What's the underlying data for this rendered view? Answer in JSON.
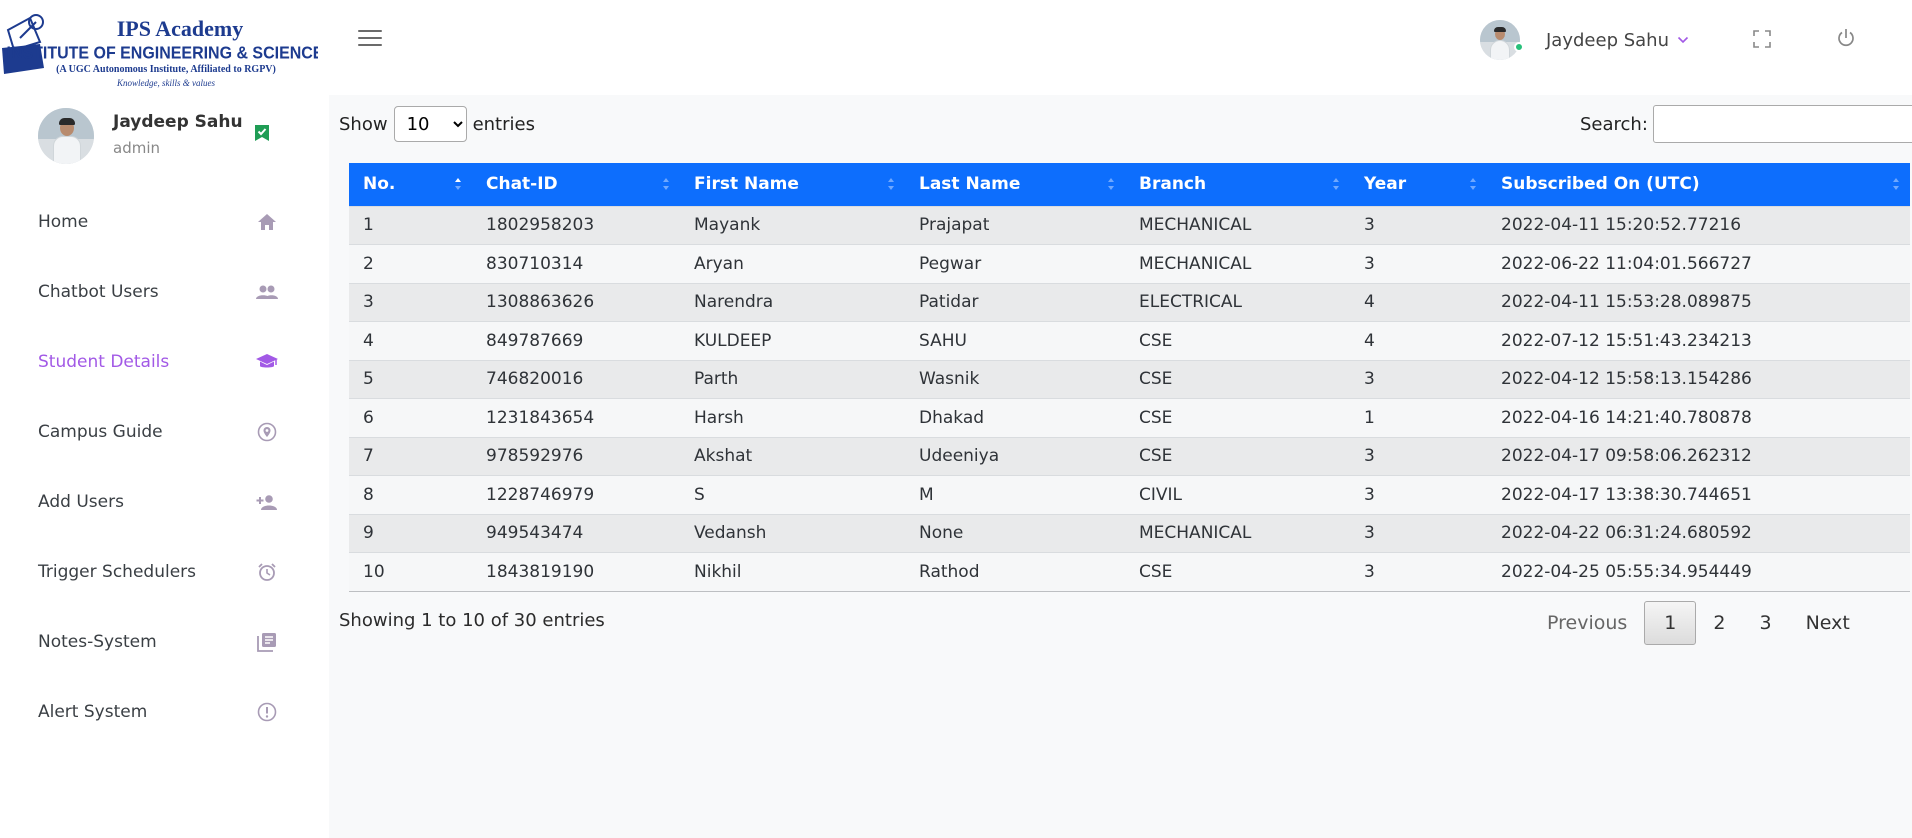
{
  "brand": {
    "name": "IPS Academy",
    "institute": "INSTITUTE OF ENGINEERING & SCIENCE",
    "affiliation": "(A UGC Autonomous Institute, Affiliated to RGPV)",
    "motto": "Knowledge, skills & values"
  },
  "user": {
    "name": "Jaydeep Sahu",
    "role": "admin"
  },
  "sidebar": {
    "items": [
      {
        "label": "Home",
        "icon": "home-icon",
        "active": false
      },
      {
        "label": "Chatbot Users",
        "icon": "users-icon",
        "active": false
      },
      {
        "label": "Student Details",
        "icon": "graduation-cap-icon",
        "active": true
      },
      {
        "label": "Campus Guide",
        "icon": "location-pin-icon",
        "active": false
      },
      {
        "label": "Add Users",
        "icon": "add-user-icon",
        "active": false
      },
      {
        "label": "Trigger Schedulers",
        "icon": "alarm-clock-icon",
        "active": false
      },
      {
        "label": "Notes-System",
        "icon": "notes-icon",
        "active": false
      },
      {
        "label": "Alert System",
        "icon": "alert-circle-icon",
        "active": false
      }
    ]
  },
  "colors": {
    "accent": "#a259e6",
    "header_blue": "#0d6efd",
    "online": "#27c07a"
  },
  "table_controls": {
    "show_label": "Show",
    "entries_label": "entries",
    "page_length": "10",
    "search_label": "Search:",
    "search_value": ""
  },
  "table": {
    "columns": [
      "No.",
      "Chat-ID",
      "First Name",
      "Last Name",
      "Branch",
      "Year",
      "Subscribed On (UTC)"
    ],
    "rows": [
      [
        "1",
        "1802958203",
        "Mayank",
        "Prajapat",
        "MECHANICAL",
        "3",
        "2022-04-11 15:20:52.77216"
      ],
      [
        "2",
        "830710314",
        "Aryan",
        "Pegwar",
        "MECHANICAL",
        "3",
        "2022-06-22 11:04:01.566727"
      ],
      [
        "3",
        "1308863626",
        "Narendra",
        "Patidar",
        "ELECTRICAL",
        "4",
        "2022-04-11 15:53:28.089875"
      ],
      [
        "4",
        "849787669",
        "KULDEEP",
        "SAHU",
        "CSE",
        "4",
        "2022-07-12 15:51:43.234213"
      ],
      [
        "5",
        "746820016",
        "Parth",
        "Wasnik",
        "CSE",
        "3",
        "2022-04-12 15:58:13.154286"
      ],
      [
        "6",
        "1231843654",
        "Harsh",
        "Dhakad",
        "CSE",
        "1",
        "2022-04-16 14:21:40.780878"
      ],
      [
        "7",
        "978592976",
        "Akshat",
        "Udeeniya",
        "CSE",
        "3",
        "2022-04-17 09:58:06.262312"
      ],
      [
        "8",
        "1228746979",
        "S",
        "M",
        "CIVIL",
        "3",
        "2022-04-17 13:38:30.744651"
      ],
      [
        "9",
        "949543474",
        "Vedansh",
        "None",
        "MECHANICAL",
        "3",
        "2022-04-22 06:31:24.680592"
      ],
      [
        "10",
        "1843819190",
        "Nikhil",
        "Rathod",
        "CSE",
        "3",
        "2022-04-25 05:55:34.954449"
      ]
    ]
  },
  "footer": {
    "info": "Showing 1 to 10 of 30 entries",
    "previous": "Previous",
    "next": "Next",
    "pages": [
      "1",
      "2",
      "3"
    ],
    "current_page": "1"
  }
}
